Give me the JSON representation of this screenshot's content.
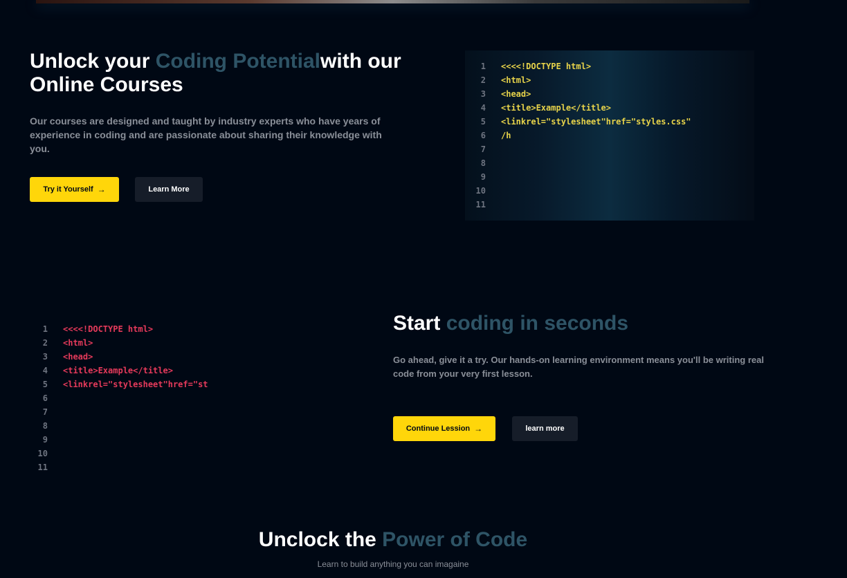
{
  "section1": {
    "heading_prefix": "Unlock your ",
    "heading_accent": "Coding Potential",
    "heading_suffix": "with our Online Courses",
    "description": "Our courses are designed and taught by industry experts who have years of experience in coding and are passionate about sharing their knowledge with you.",
    "primary_button": "Try it Yourself",
    "secondary_button": "Learn More",
    "code": {
      "line_numbers": [
        "1",
        "2",
        "3",
        "4",
        "5",
        "6",
        "7",
        "8",
        "9",
        "10",
        "11"
      ],
      "lines": [
        "<<<<!DOCTYPE html>",
        "<html>",
        "<head>",
        "<title>Example</title>",
        "<linkrel=\"stylesheet\"href=\"styles.css\"",
        "/h"
      ],
      "text_color": "#e7d34a"
    }
  },
  "section2": {
    "heading_prefix": "Start ",
    "heading_accent": "coding in seconds",
    "description": "Go ahead, give it a try. Our hands-on learning environment means you'll be writing real code from your very first lesson.",
    "primary_button": "Continue Lession",
    "secondary_button": "learn more",
    "code": {
      "line_numbers": [
        "1",
        "2",
        "3",
        "4",
        "5",
        "6",
        "7",
        "8",
        "9",
        "10",
        "11"
      ],
      "lines": [
        "<<<<!DOCTYPE html>",
        "<html>",
        "<head>",
        "<title>Example</title>",
        "<linkrel=\"stylesheet\"href=\"st"
      ],
      "text_color": "#e63a5b"
    }
  },
  "section3": {
    "heading_prefix": "Unclock the ",
    "heading_accent": "Power of Code",
    "subtitle": "Learn to build anything you can imagaine"
  },
  "colors": {
    "background": "#000814",
    "accent_text": "#2e5466",
    "yellow_button": "#ffd60a",
    "dark_button": "#161d29"
  },
  "icons": {
    "button_arrow": "arrow-right-icon"
  }
}
